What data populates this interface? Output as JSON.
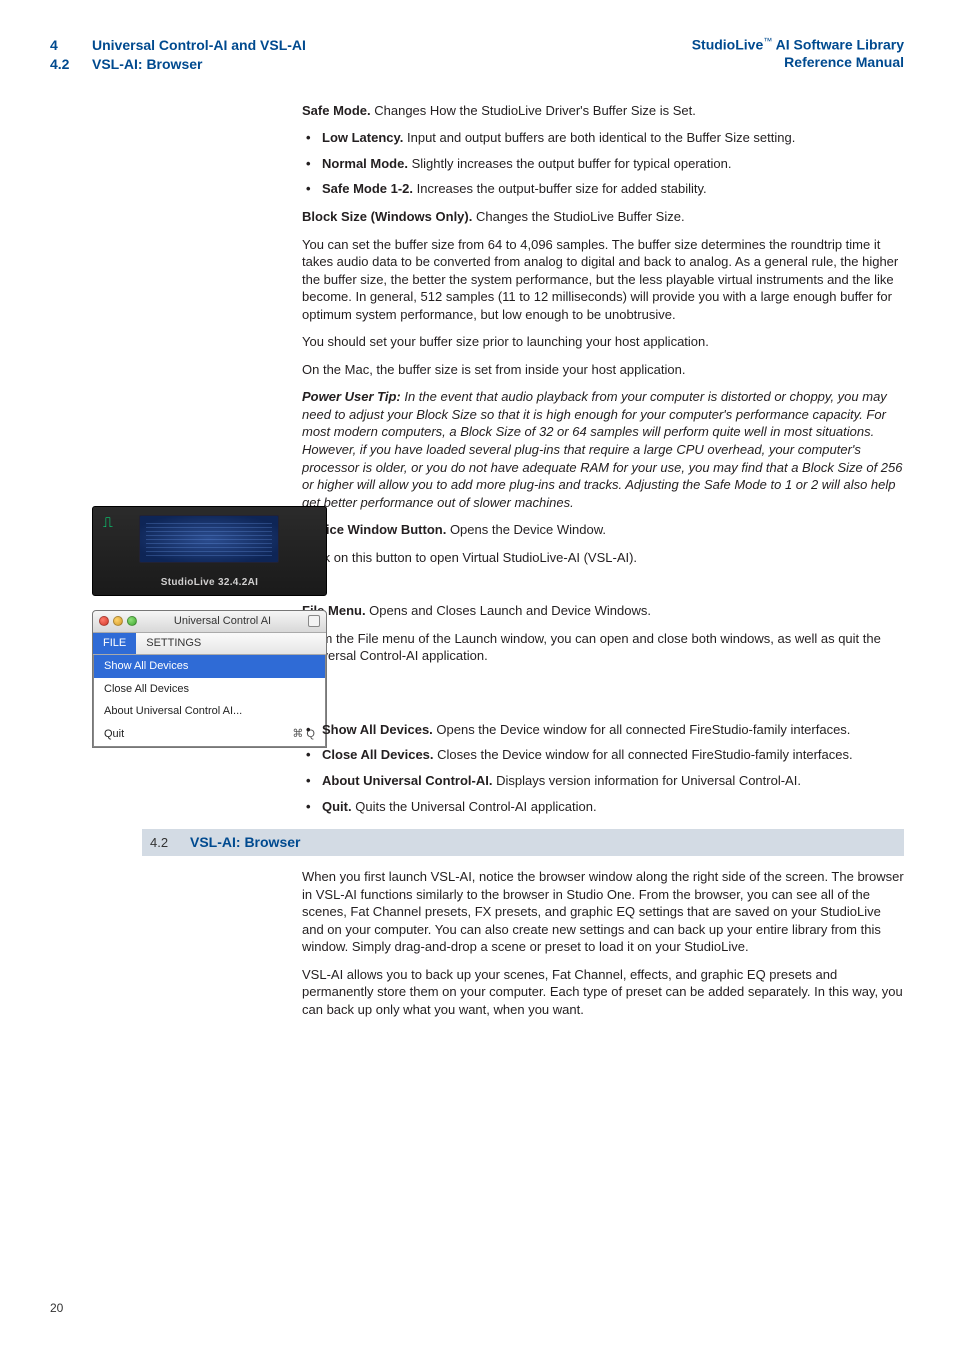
{
  "header": {
    "chapter_num": "4",
    "chapter_title": "Universal Control-AI and VSL-AI",
    "section_num": "4.2",
    "section_title": "VSL-AI: Browser",
    "book_title_1": "StudioLive",
    "book_title_2": " AI Software Library",
    "book_subtitle": "Reference Manual"
  },
  "safe_mode": {
    "heading": "Safe Mode.",
    "heading_text": " Changes How the StudioLive Driver's Buffer Size is Set.",
    "items": [
      {
        "b": "Low Latency.",
        "t": " Input and output buffers are both identical to the Buffer Size setting."
      },
      {
        "b": "Normal Mode.",
        "t": " Slightly increases the output buffer for typical operation."
      },
      {
        "b": "Safe Mode 1-2.",
        "t": " Increases the output-buffer size for added stability."
      }
    ]
  },
  "block_size": {
    "heading": "Block Size (Windows Only).",
    "heading_text": " Changes the StudioLive Buffer Size.",
    "p1": "You can set the buffer size from 64 to 4,096 samples. The buffer size determines the roundtrip time it takes audio data to be converted from analog to digital and back to analog. As a general rule, the higher the buffer size, the better the system performance, but the less playable virtual instruments and the like become. In general, 512 samples (11 to 12 milliseconds) will provide you with a large enough buffer for optimum system performance, but low enough to be unobtrusive.",
    "p2": "You should set your buffer size prior to launching your host application.",
    "p3": "On the Mac, the buffer size is set from inside your host application."
  },
  "power_tip": {
    "lead": "Power User Tip:",
    "text": " In the event that audio playback from your computer is distorted or choppy, you may need to adjust your Block Size so that it is high enough for your computer's performance capacity. For most modern computers, a Block Size of 32 or 64 samples will perform quite well in most situations. However, if you have loaded several plug-ins that require a large CPU overhead, your computer's processor is older, or you do not have adequate RAM for your use, you may find that a Block Size of 256 or higher will allow you to add more plug-ins and tracks. Adjusting the Safe Mode to 1 or 2 will also help get better performance out of slower machines."
  },
  "device_button": {
    "heading": "Device Window Button.",
    "heading_text": " Opens the Device Window.",
    "p": "Click on this button to open Virtual StudioLive-AI (VSL-AI).",
    "fig_label": "StudioLive 32.4.2AI"
  },
  "file_menu": {
    "heading": "File Menu.",
    "heading_text": " Opens and Closes Launch and Device Windows.",
    "p": "From the File menu of the Launch window, you can open and close both windows, as well as quit the Universal Control-AI application.",
    "window_title": "Universal Control AI",
    "menubar": {
      "file": "FILE",
      "settings": "SETTINGS"
    },
    "dropdown": [
      {
        "label": "Show All Devices",
        "hl": true
      },
      {
        "label": "Close All Devices"
      },
      {
        "label": "About Universal Control AI..."
      },
      {
        "label": "Quit",
        "shortcut": "⌘ Q"
      }
    ],
    "items": [
      {
        "b": "Show All Devices.",
        "t": " Opens the Device window for all connected FireStudio-family interfaces."
      },
      {
        "b": "Close All Devices.",
        "t": " Closes the Device window for all connected FireStudio-family interfaces."
      },
      {
        "b": "About Universal Control-AI.",
        "t": " Displays version information for Universal Control-AI."
      },
      {
        "b": "Quit.",
        "t": " Quits the Universal Control-AI application."
      }
    ]
  },
  "section_42": {
    "num": "4.2",
    "title": "VSL-AI: Browser",
    "p1": "When you first launch VSL-AI, notice the browser window along the right side of the screen. The browser in VSL-AI functions similarly to the browser in Studio One. From the browser, you can see all of the scenes, Fat Channel presets, FX presets, and graphic EQ settings that are saved on your StudioLive and on your computer. You can also create new settings and can back up your entire library from this window. Simply drag-and-drop a scene or preset to load it on your StudioLive.",
    "p2": "VSL-AI allows you to back up your scenes, Fat Channel, effects, and graphic EQ presets and permanently store them on your computer. Each type of preset can be added separately. In this way, you can back up only what you want, when you want."
  },
  "page_number": "20"
}
